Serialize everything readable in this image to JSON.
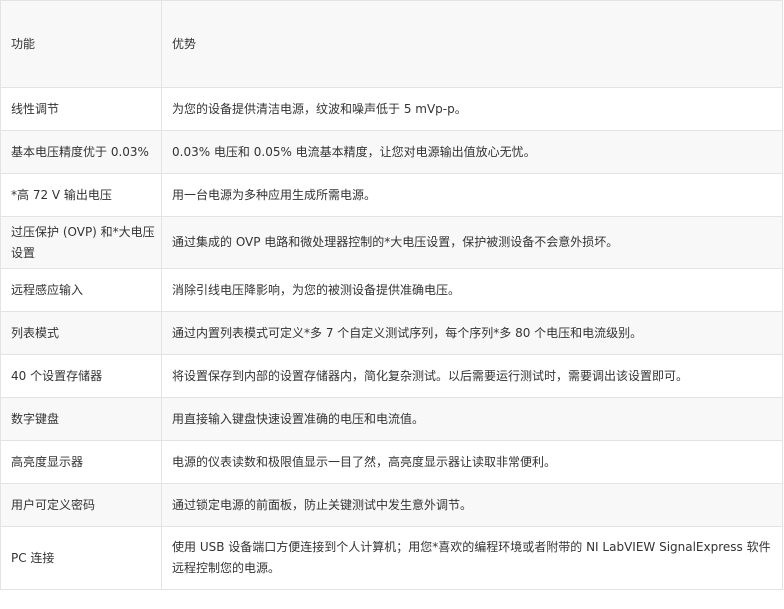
{
  "table": {
    "header": {
      "feature": "功能",
      "advantage": "优势"
    },
    "rows": [
      {
        "feature": "线性调节",
        "advantage": "为您的设备提供清洁电源，纹波和噪声低于 5 mVp-p。"
      },
      {
        "feature": "基本电压精度优于 0.03%",
        "advantage": "0.03% 电压和 0.05% 电流基本精度，让您对电源输出值放心无忧。"
      },
      {
        "feature": "*高 72 V 输出电压",
        "advantage": "用一台电源为多种应用生成所需电源。"
      },
      {
        "feature": "过压保护 (OVP) 和*大电压设置",
        "advantage": "通过集成的 OVP 电路和微处理器控制的*大电压设置，保护被测设备不会意外损坏。"
      },
      {
        "feature": "远程感应输入",
        "advantage": "消除引线电压降影响，为您的被测设备提供准确电压。"
      },
      {
        "feature": "列表模式",
        "advantage": "通过内置列表模式可定义*多 7 个自定义测试序列，每个序列*多 80 个电压和电流级别。"
      },
      {
        "feature": "40 个设置存储器",
        "advantage": "将设置保存到内部的设置存储器内，简化复杂测试。以后需要运行测试时，需要调出该设置即可。"
      },
      {
        "feature": "数字键盘",
        "advantage": "用直接输入键盘快速设置准确的电压和电流值。"
      },
      {
        "feature": "高亮度显示器",
        "advantage": "电源的仪表读数和极限值显示一目了然，高亮度显示器让读取非常便利。"
      },
      {
        "feature": "用户可定义密码",
        "advantage": "通过锁定电源的前面板，防止关键测试中发生意外调节。"
      },
      {
        "feature": "PC 连接",
        "advantage": "使用 USB 设备端口方便连接到个人计算机；用您*喜欢的编程环境或者附带的 NI LabVIEW SignalExpress 软件远程控制您的电源。"
      }
    ]
  }
}
